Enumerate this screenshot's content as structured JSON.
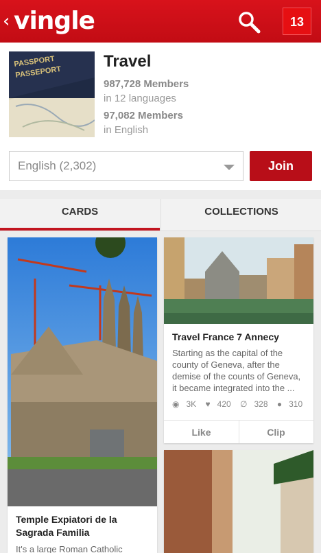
{
  "header": {
    "back": "‹",
    "logo": "vingle",
    "notifications": "13"
  },
  "group": {
    "title": "Travel",
    "members_total": "987,728 Members",
    "languages": "in 12 languages",
    "members_lang": "97,082 Members",
    "lang_label": "in English",
    "thumb_text_1": "PASSPORT",
    "thumb_text_2": "PASSEPORT",
    "language_select": "English (2,302)",
    "join": "Join"
  },
  "tabs": {
    "cards": "CARDS",
    "collections": "COLLECTIONS"
  },
  "cards": [
    {
      "title_l1": "Temple Expiatori de la",
      "title_l2": "Sagrada Familia",
      "desc": "It's a large Roman Catholic"
    },
    {
      "title": "Travel France 7 Annecy",
      "desc_l1": "Starting as the capital of the",
      "desc_l2": "county of Geneva, after the",
      "desc_l3": "demise of the counts of Geneva,",
      "desc_l4": "it became integrated into the ...",
      "views": "3K",
      "likes": "420",
      "clips": "328",
      "comments": "310",
      "like": "Like",
      "clip": "Clip"
    }
  ]
}
